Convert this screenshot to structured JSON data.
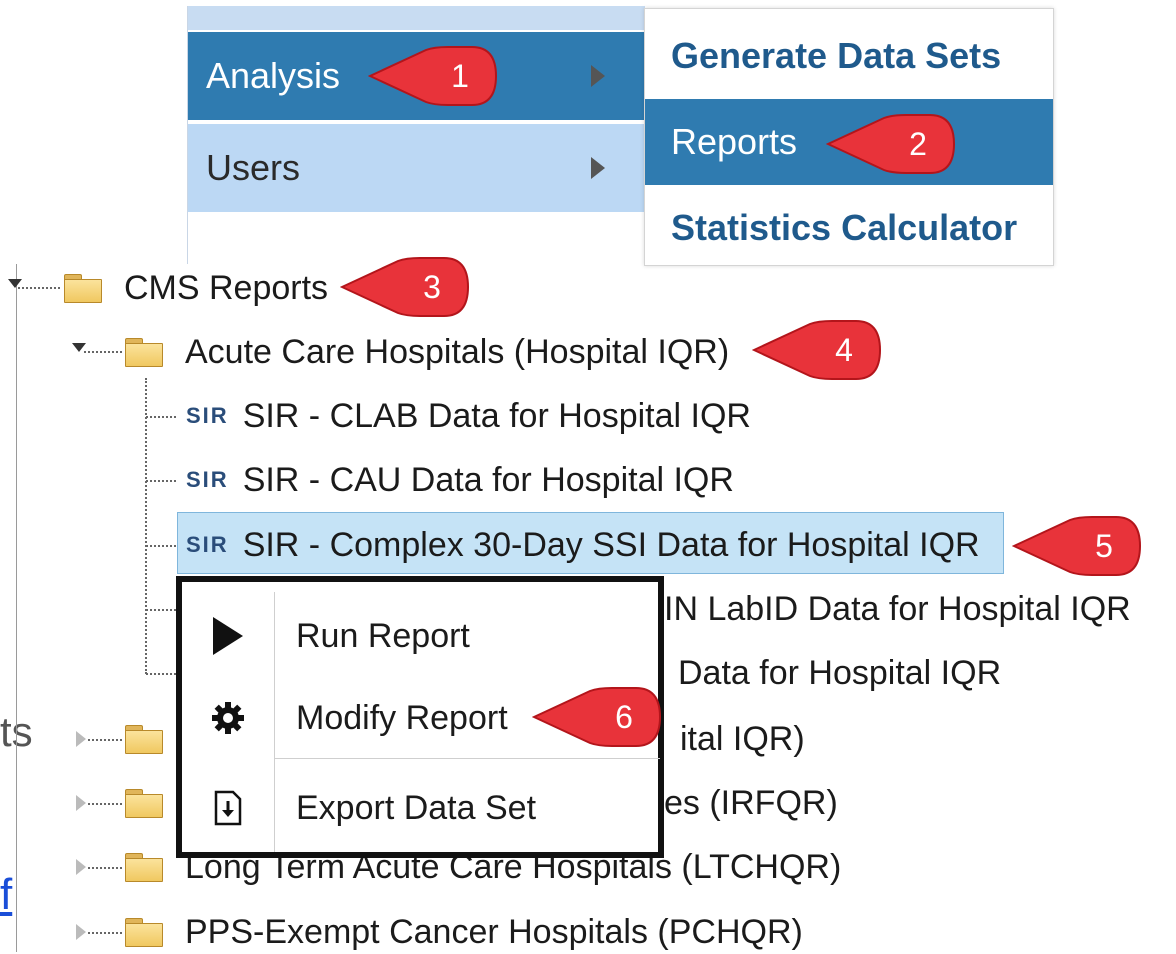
{
  "background_fragments": {
    "left_text": "ts",
    "left_link": "f"
  },
  "menu": {
    "items": [
      {
        "label": "Analysis"
      },
      {
        "label": "Users"
      }
    ],
    "submenu": [
      {
        "label": "Generate Data Sets"
      },
      {
        "label": "Reports"
      },
      {
        "label": "Statistics Calculator"
      }
    ]
  },
  "tree": {
    "root": "CMS Reports",
    "group": "Acute Care Hospitals (Hospital IQR)",
    "sir_badge": "SIR",
    "reports": [
      "SIR - CLAB Data for Hospital IQR",
      "SIR - CAU Data for Hospital IQR",
      "SIR - Complex 30-Day SSI Data for Hospital IQR",
      "IN LabID Data for Hospital IQR",
      "Data for Hospital IQR"
    ],
    "other_folders": [
      "ital IQR)",
      "es (IRFQR)",
      "Long Term Acute Care Hospitals (LTCHQR)",
      "PPS-Exempt Cancer Hospitals (PCHQR)"
    ]
  },
  "context_menu": {
    "items": [
      {
        "label": "Run Report",
        "icon": "play-icon"
      },
      {
        "label": "Modify Report",
        "icon": "gear-icon"
      },
      {
        "label": "Export Data Set",
        "icon": "export-icon"
      }
    ]
  },
  "callouts": [
    "1",
    "2",
    "3",
    "4",
    "5",
    "6"
  ],
  "colors": {
    "menu_active": "#2f7bb0",
    "menu_hover": "#bcd8f4",
    "submenu_text": "#1f5a8c",
    "callout": "#e8333a",
    "selected": "#c5e3f6"
  }
}
